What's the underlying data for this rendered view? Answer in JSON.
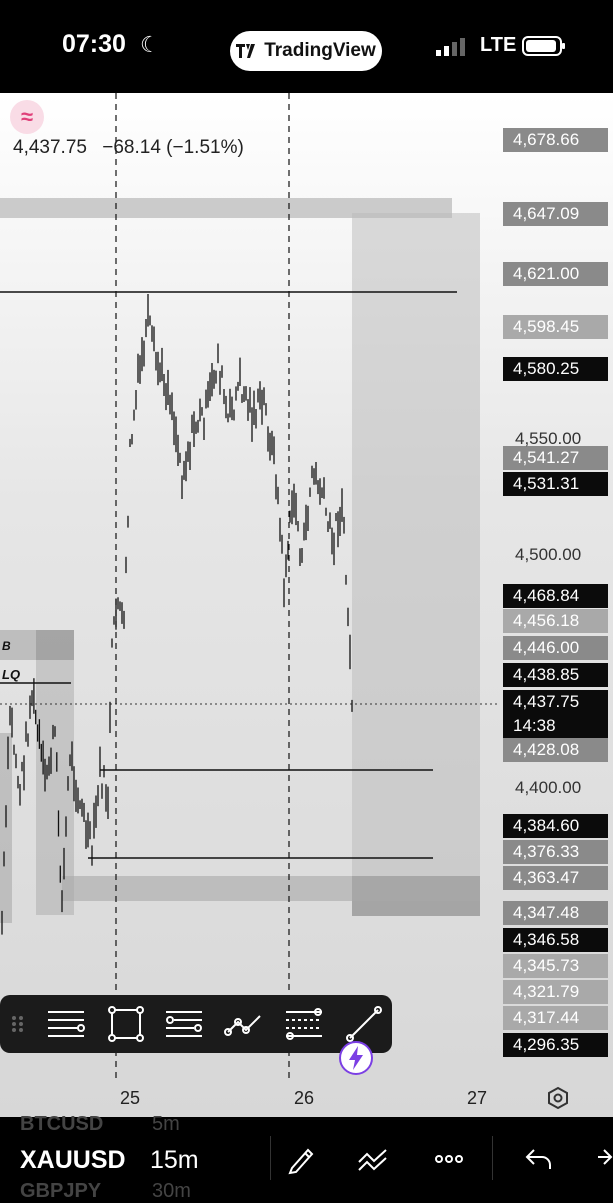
{
  "status_bar": {
    "time": "07:30",
    "app": "TradingView",
    "network": "LTE"
  },
  "quote": {
    "price": "4,437.75",
    "change": "−68.14 (−1.51%)"
  },
  "zone_labels": {
    "b": "B",
    "lq": "LQ"
  },
  "price_axis": {
    "labels": [
      "4,550.00",
      "4,500.00",
      "4,400.00"
    ],
    "tags": [
      {
        "text": "4,678.66",
        "style": "tag-grey"
      },
      {
        "text": "4,647.09",
        "style": "tag-grey"
      },
      {
        "text": "4,621.00",
        "style": "tag-grey"
      },
      {
        "text": "4,598.45",
        "style": "tag-lightgrey"
      },
      {
        "text": "4,580.25",
        "style": "tag-black"
      },
      {
        "text": "4,541.27",
        "style": "tag-grey"
      },
      {
        "text": "4,531.31",
        "style": "tag-black"
      },
      {
        "text": "4,468.84",
        "style": "tag-black"
      },
      {
        "text": "4,456.18",
        "style": "tag-lightgrey"
      },
      {
        "text": "4,446.00",
        "style": "tag-grey"
      },
      {
        "text": "4,438.85",
        "style": "tag-black"
      },
      {
        "text": "4,437.75",
        "style": "tag-black"
      },
      {
        "text": "4,428.08",
        "style": "tag-grey"
      },
      {
        "text": "4,384.60",
        "style": "tag-black"
      },
      {
        "text": "4,376.33",
        "style": "tag-grey"
      },
      {
        "text": "4,363.47",
        "style": "tag-grey"
      },
      {
        "text": "4,347.48",
        "style": "tag-grey"
      },
      {
        "text": "4,346.58",
        "style": "tag-black"
      },
      {
        "text": "4,345.73",
        "style": "tag-lightgrey"
      },
      {
        "text": "4,321.79",
        "style": "tag-lightgrey"
      },
      {
        "text": "4,317.44",
        "style": "tag-lightgrey"
      },
      {
        "text": "4,296.35",
        "style": "tag-black"
      }
    ],
    "countdown": "14:38"
  },
  "date_axis": [
    "25",
    "26",
    "27"
  ],
  "toolbar": {
    "tools": [
      "horizontal-lines-icon",
      "rectangle-icon",
      "parallel-channel-icon",
      "path-icon",
      "fib-icon",
      "trendline-icon"
    ]
  },
  "bottom_bar": {
    "prev_symbol": "BTCUSD",
    "prev_timeframe": "5m",
    "symbol": "XAUUSD",
    "timeframe": "15m",
    "next_symbol": "GBPJPY",
    "next_timeframe": "30m"
  },
  "colors": {
    "accent": "#e0407a",
    "flash": "#7b3fe4"
  }
}
